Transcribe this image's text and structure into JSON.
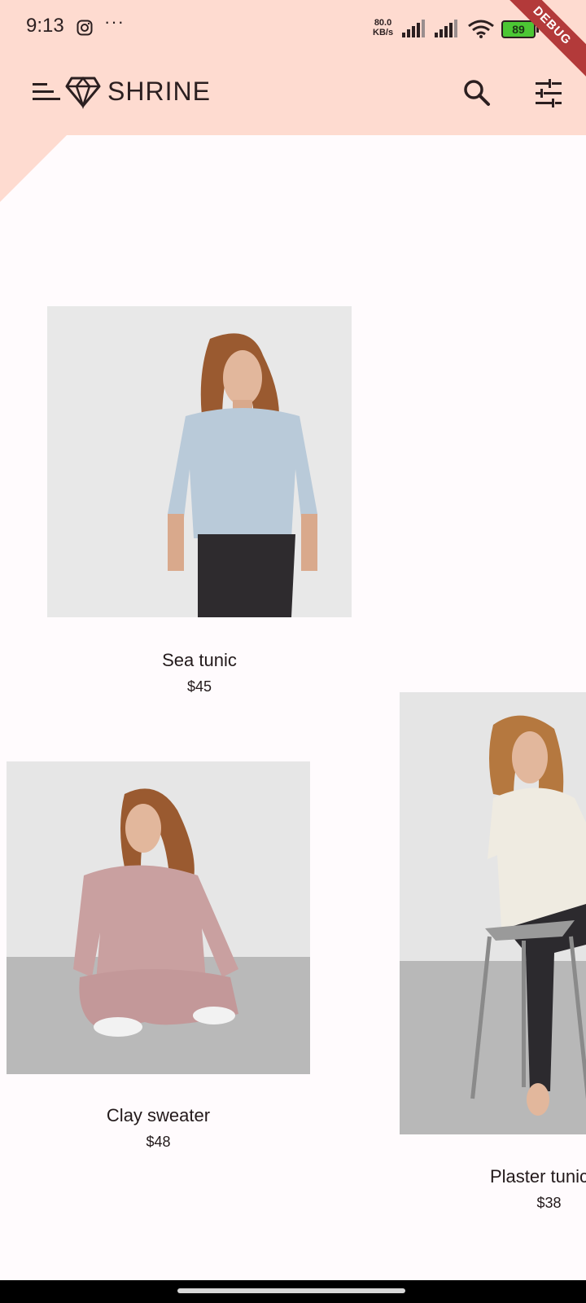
{
  "status_bar": {
    "time": "9:13",
    "more": "···",
    "net_speed_value": "80.0",
    "net_speed_unit": "KB/s",
    "battery": "89",
    "instagram_icon": "instagram-icon",
    "signal_icon": "cellular-signal-icon",
    "wifi_icon": "wifi-icon"
  },
  "debug_banner": "DEBUG",
  "app_bar": {
    "brand": "SHRINE",
    "menu_icon": "menu-icon",
    "logo_icon": "diamond-icon",
    "search_icon": "search-icon",
    "filter_icon": "tune-icon"
  },
  "colors": {
    "header_bg": "#fedbd0",
    "page_bg": "#fffbfd",
    "text": "#442b2d"
  },
  "products": [
    {
      "name": "Sea tunic",
      "price": "$45"
    },
    {
      "name": "Clay sweater",
      "price": "$48"
    },
    {
      "name": "Plaster tunic",
      "price": "$38"
    }
  ]
}
